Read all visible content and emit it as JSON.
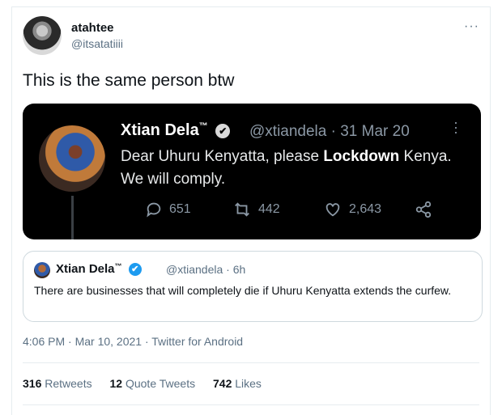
{
  "tweet": {
    "display_name": "atahtee",
    "handle": "@itsatatiiii",
    "more_icon": "more-icon",
    "text": "This is the same person btw",
    "timestamp": "4:06 PM · Mar 10, 2021 · Twitter for Android"
  },
  "embedded": {
    "name": "Xtian Dela",
    "tm": "™",
    "handle_date": "@xtiandela · 31 Mar 20",
    "body_pre": "Dear Uhuru Kenyatta, please ",
    "body_bold": "Lockdown",
    "body_post": " Kenya. We will comply.",
    "replies": "651",
    "retweets": "442",
    "likes": "2,643"
  },
  "quoted": {
    "name": "Xtian Dela",
    "tm": "™",
    "handle_time": "@xtiandela · 6h",
    "text": "There are businesses that will completely die if Uhuru Kenyatta extends the curfew."
  },
  "stats": {
    "retweets_count": "316",
    "retweets_label": "Retweets",
    "quotes_count": "12",
    "quotes_label": "Quote Tweets",
    "likes_count": "742",
    "likes_label": "Likes"
  },
  "colors": {
    "accent": "#1d9bf0",
    "muted": "#5b7083",
    "border": "#e6ecf0"
  }
}
